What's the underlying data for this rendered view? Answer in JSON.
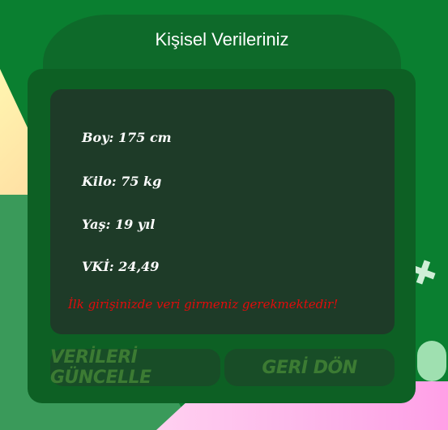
{
  "window": {
    "title": "Kişisel Verileriniz"
  },
  "info": {
    "boy": "Boy: 175 cm",
    "kilo": "Kilo: 75 kg",
    "yas": "Yaş: 19 yıl",
    "vki": "VKİ: 24,49",
    "warning": "İlk girişinizde veri girmeniz gerekmektedir!"
  },
  "buttons": {
    "update_label": "VERİLERİ GÜNCELLE",
    "back_label": "GERİ DÖN"
  },
  "colors": {
    "background": "#0a7f30",
    "panel": "#0d6024",
    "inner": "#1e3b28",
    "warning": "#e30b0b",
    "button_text": "#3c7b33"
  }
}
